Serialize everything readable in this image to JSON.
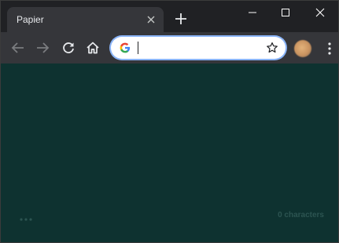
{
  "tab": {
    "title": "Papier"
  },
  "toolbar": {
    "address_value": ""
  },
  "editor": {
    "char_count_label": "0 characters"
  },
  "colors": {
    "tabstrip": "#202124",
    "toolbar": "#35363a",
    "content_bg": "#0e3230",
    "focus_ring": "#8ab4f8"
  },
  "icons": [
    "back-arrow-icon",
    "forward-arrow-icon",
    "reload-icon",
    "home-icon",
    "google-g-icon",
    "star-icon",
    "more-vert-icon",
    "close-icon",
    "plus-icon",
    "minimize-icon",
    "maximize-icon"
  ]
}
